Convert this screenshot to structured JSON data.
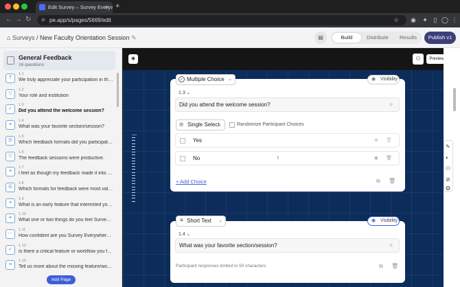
{
  "browser": {
    "tab_title": "Edit Survey – Survey Everywh",
    "url": "pe.app/s/pages/5669/edit",
    "new_tab": "+"
  },
  "header": {
    "breadcrumb_root": "Surveys",
    "breadcrumb_sep": "/",
    "breadcrumb_current": "New Faculty Orientation Session",
    "edit_icon": "✎",
    "tabs": [
      "Build",
      "Distribute",
      "Results"
    ],
    "publish_label": "Publish v1"
  },
  "sidebar": {
    "title": "General Feedback",
    "count": "16 questions",
    "items": [
      {
        "num": "1.1",
        "text": "We truly appreciate your participation in the ...",
        "icon": "T",
        "active": false
      },
      {
        "num": "1.2",
        "text": "Your role and institution",
        "icon": "▽",
        "active": false
      },
      {
        "num": "1.3",
        "text": "Did you attend the welcome session?",
        "icon": "✓",
        "active": true
      },
      {
        "num": "1.4",
        "text": "What was your favorite section/session?",
        "icon": "≡",
        "active": false
      },
      {
        "num": "1.5",
        "text": "Which feedback formats did you participate i...",
        "icon": "☰",
        "active": false
      },
      {
        "num": "1.6",
        "text": "The feedback sessions were productive.",
        "icon": "▽",
        "active": false
      },
      {
        "num": "1.7",
        "text": "I feel as though my feedback made it into the ...",
        "icon": "≡",
        "active": false
      },
      {
        "num": "1.8",
        "text": "Which formats for feedback were most valua...",
        "icon": "☰",
        "active": false
      },
      {
        "num": "1.9",
        "text": "What is an early feature that interested you a...",
        "icon": "≡",
        "active": false
      },
      {
        "num": "1.10",
        "text": "What one or two things do you feel Survey Ev...",
        "icon": "≡",
        "active": false
      },
      {
        "num": "1.11",
        "text": "How confident are you Survey Everywhere m...",
        "icon": "⋯",
        "active": false
      },
      {
        "num": "1.12",
        "text": "Is there a critical feature or workflow you feel ...",
        "icon": "✓",
        "active": false
      },
      {
        "num": "1.13",
        "text": "Tell us more about the missing feature/workflo...",
        "icon": "≡",
        "active": false
      }
    ],
    "add_page": "Add Page"
  },
  "canvas": {
    "preview": "Preview",
    "card1": {
      "type": "Multiple Choice",
      "visibility": "Visibility",
      "qnum": "1.3",
      "question": "Did you attend the welcome session?",
      "select_mode": "Single Select",
      "randomize": "Randomize Participant Choices",
      "options": [
        "Yes",
        "No"
      ],
      "add_choice": "+ Add Choice"
    },
    "card2": {
      "type": "Short Text",
      "visibility": "Visibility",
      "qnum": "1.4",
      "question": "What was your favorite section/session?",
      "limit": "Participant responses limited to 50 characters"
    }
  },
  "colors": {
    "accent": "#3d5fd6",
    "publish": "#3c3f7a",
    "canvas": "#0c2c5a"
  }
}
